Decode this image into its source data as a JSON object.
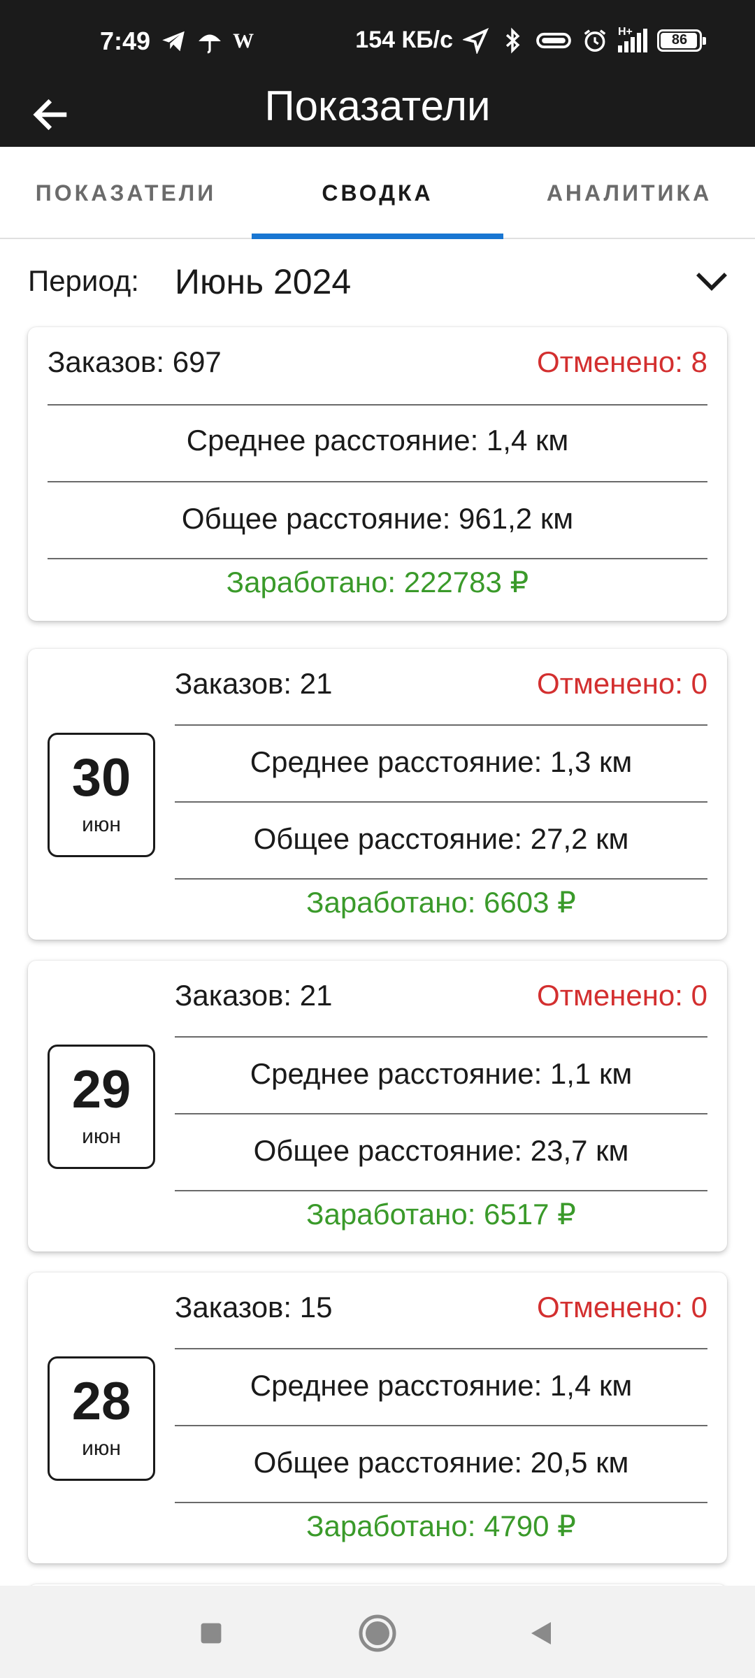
{
  "status_bar": {
    "time": "7:49",
    "left_icons": [
      "telegram-icon",
      "umbrella-icon",
      "w-icon"
    ],
    "network_speed": "154 КБ/с",
    "right_icons": [
      "location-arrow-icon",
      "bluetooth-icon",
      "pill-icon",
      "alarm-icon",
      "signal-icon"
    ],
    "signal_type": "H+",
    "battery": "86",
    "w_glyph": "W"
  },
  "toolbar": {
    "title": "Показатели",
    "back_icon": "arrow-left-icon"
  },
  "tabs": [
    {
      "label": "ПОКАЗАТЕЛИ",
      "active": false
    },
    {
      "label": "СВОДКА",
      "active": true
    },
    {
      "label": "АНАЛИТИКА",
      "active": false
    }
  ],
  "period": {
    "label": "Период:",
    "value": "Июнь 2024"
  },
  "summary": {
    "orders": "Заказов: 697",
    "cancelled": "Отменено: 8",
    "avg_distance": "Среднее расстояние: 1,4 км",
    "total_distance": "Общее расстояние: 961,2 км",
    "earned": "Заработано: 222783 ₽"
  },
  "days": [
    {
      "day": "30",
      "month": "июн",
      "orders": "Заказов: 21",
      "cancelled": "Отменено: 0",
      "avg_distance": "Среднее расстояние: 1,3 км",
      "total_distance": "Общее расстояние: 27,2 км",
      "earned": "Заработано: 6603 ₽"
    },
    {
      "day": "29",
      "month": "июн",
      "orders": "Заказов: 21",
      "cancelled": "Отменено: 0",
      "avg_distance": "Среднее расстояние: 1,1 км",
      "total_distance": "Общее расстояние: 23,7 км",
      "earned": "Заработано: 6517 ₽"
    },
    {
      "day": "28",
      "month": "июн",
      "orders": "Заказов: 15",
      "cancelled": "Отменено: 0",
      "avg_distance": "Среднее расстояние: 1,4 км",
      "total_distance": "Общее расстояние: 20,5 км",
      "earned": "Заработано: 4790 ₽"
    }
  ],
  "colors": {
    "accent": "#1976d2",
    "cancelled": "#d32f2f",
    "earned": "#3a9a2a",
    "bar": "#1b1b1b"
  },
  "navbar": [
    "square-recents-icon",
    "circle-home-icon",
    "triangle-back-icon"
  ]
}
